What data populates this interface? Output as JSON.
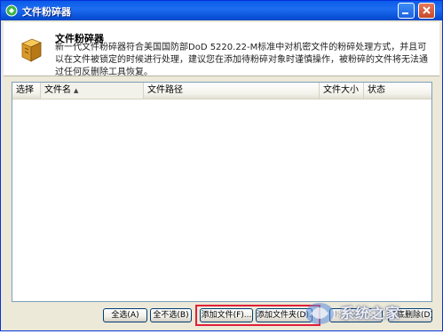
{
  "window": {
    "title": "文件粉碎器",
    "accent_color": "#0a5be8"
  },
  "header": {
    "app_name": "文件粉碎器",
    "description": "新一代文件粉碎器符合美国国防部DoD 5220.22-M标准中对机密文件的粉碎处理方式，并且可以在文件被锁定的时候进行处理，建议您在添加待粉碎对象时谨慎操作，被粉碎的文件将无法通过任何反删除工具恢复。",
    "icon": "shredder-box-icon"
  },
  "file_list": {
    "columns": [
      {
        "label": "选择"
      },
      {
        "label": "文件名",
        "sort": "ascending"
      },
      {
        "label": "文件路径"
      },
      {
        "label": "文件大小"
      },
      {
        "label": "状态"
      }
    ],
    "rows": []
  },
  "buttons": {
    "select_all": "全选(A)",
    "deselect_all": "全不选(B)",
    "add_file": "添加文件(F)...",
    "add_folder": "添加文件夹(D)...",
    "shred": "粉碎文件(S)",
    "delete_all": "彻底删除(D)"
  },
  "highlight_color": "#e0203a",
  "watermark": {
    "text": "系统之家"
  }
}
